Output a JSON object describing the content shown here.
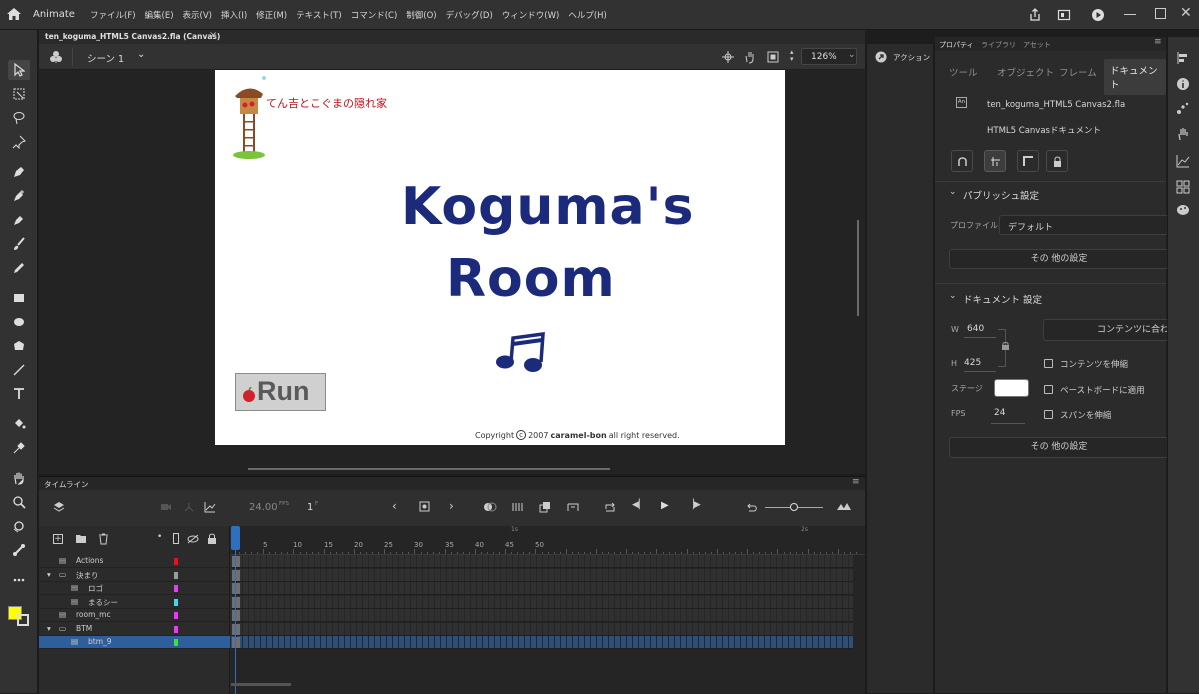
{
  "app": {
    "name": "Animate"
  },
  "menus": [
    "ファイル(F)",
    "編集(E)",
    "表示(V)",
    "挿入(I)",
    "修正(M)",
    "テキスト(T)",
    "コマンド(C)",
    "制御(O)",
    "デバッグ(D)",
    "ウィンドウ(W)",
    "ヘルプ(H)"
  ],
  "document": {
    "tab_title": "ten_koguma_HTML5 Canvas2.fla (Canvas)"
  },
  "editbar": {
    "scene": "シーン 1",
    "zoom": "126%"
  },
  "stage": {
    "site_title": "てん吉とこぐまの隠れ家",
    "logo_line1": "Koguma's",
    "logo_line2": "Room",
    "run_button": "Run",
    "copyright_prefix": "Copyright",
    "copyright_symbol": "c",
    "copyright_year": "2007",
    "copyright_brand": "caramel-bon",
    "copyright_suffix": "all right reserved."
  },
  "timeline": {
    "tab_label": "タイムライン",
    "fps_value": "24.00",
    "fps_unit": "FPS",
    "frame_value": "1",
    "frame_unit": "F",
    "ruler_numbers": [
      "5",
      "10",
      "15",
      "20",
      "25",
      "30",
      "35",
      "40",
      "45",
      "50"
    ],
    "ruler_seconds": [
      "1s",
      "2s"
    ],
    "layers": [
      {
        "name": "Actions",
        "color": "#e8121a",
        "indent": 0,
        "folder": false
      },
      {
        "name": "決まり",
        "color": "#9b9b9b",
        "indent": 0,
        "folder": true
      },
      {
        "name": "ロゴ",
        "color": "#e63df0",
        "indent": 1,
        "folder": false
      },
      {
        "name": "まるシー",
        "color": "#31e0e8",
        "indent": 1,
        "folder": false
      },
      {
        "name": "room_mc",
        "color": "#e63df0",
        "indent": 0,
        "folder": false
      },
      {
        "name": "BTM",
        "color": "#e63df0",
        "indent": 0,
        "folder": true
      },
      {
        "name": "btm_9",
        "color": "#37e632",
        "indent": 1,
        "folder": false
      }
    ],
    "selected_layer": "btm_9"
  },
  "actions_panel": {
    "label": "アクション"
  },
  "properties": {
    "tabs": [
      "プロパティ",
      "ライブラリ",
      "アセット"
    ],
    "subtabs": [
      "ツール",
      "オブジェクト",
      "フレーム",
      "ドキュメント"
    ],
    "active_subtab": "ドキュメント",
    "file_name": "ten_koguma_HTML5 Canvas2.fla",
    "doc_type": "HTML5 Canvasドキュメント",
    "publish_section": "パブリッシュ設定",
    "profile_label": "プロファイル",
    "profile_value": "デフォルト",
    "more_settings": "その 他の設定",
    "document_section": "ドキュメント 設定",
    "width_label": "W",
    "width_value": "640",
    "height_label": "H",
    "height_value": "425",
    "fit_button": "コンテンツに合わ",
    "scale_content": "コンテンツを伸縮",
    "stage_label": "ステージ",
    "stage_color": "#ffffff",
    "pasteboard": "ペーストボードに適用",
    "fps_label": "FPS",
    "fps_value": "24",
    "scale_spans": "スパンを伸縮",
    "more_settings2": "その 他の設定"
  },
  "colors": {
    "accent": "#2f6fc0",
    "selection_fill": "#ffff00",
    "logo_navy": "#1c2a7c",
    "title_red": "#c0101c"
  }
}
